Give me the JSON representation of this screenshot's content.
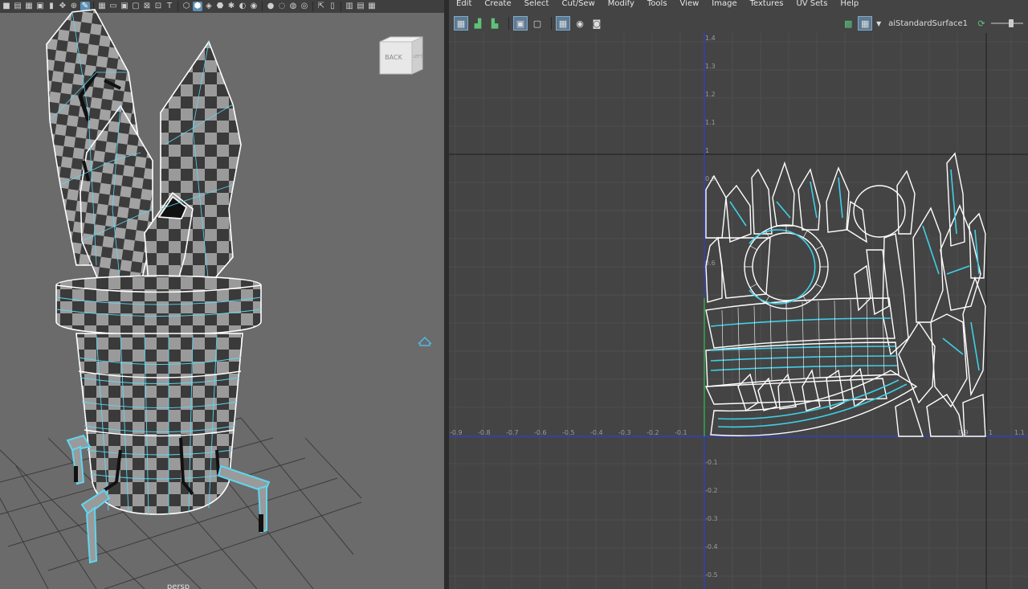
{
  "viewport": {
    "camera_label": "persp",
    "viewcube": {
      "face_front": "BACK",
      "face_side": "LEFT"
    },
    "toolbar_icons": [
      "camera-icon",
      "book-icon",
      "film-icon",
      "image-plane-icon",
      "2d-pan-icon",
      "grease-pencil-icon",
      "grid-icon",
      "wireframe-icon",
      "smooth-shade-icon",
      "textured-icon",
      "lights-icon",
      "shadows-icon",
      "ao-icon",
      "motion-blur-icon",
      "aa-icon",
      "isolate-icon",
      "xray-icon",
      "layout-icon",
      "panel-icon"
    ]
  },
  "uv_editor": {
    "menus": [
      "Edit",
      "Create",
      "Select",
      "Cut/Sew",
      "Modify",
      "Tools",
      "View",
      "Image",
      "Textures",
      "UV Sets",
      "Help"
    ],
    "toolbar_icons": [
      "uv-shell-icon",
      "uv-unfold-icon",
      "uv-layout-icon",
      "uv-grid-icon",
      "uv-snap-icon",
      "uv-checker-icon",
      "uv-isolate-icon",
      "uv-snapshot-icon"
    ],
    "shader_name": "aiStandardSurface1",
    "x_ticks": [
      "-0.9",
      "-0.8",
      "-0.7",
      "-0.6",
      "-0.5",
      "-0.4",
      "-0.3",
      "-0.2",
      "-0.1",
      "0.9",
      "1",
      "1.1"
    ],
    "y_ticks_pos": [
      "1.4",
      "1.3",
      "1.2",
      "1.1",
      "1",
      "0.9",
      "0.6"
    ],
    "y_ticks_neg": [
      "-0.1",
      "-0.2",
      "-0.3",
      "-0.4",
      "-0.5"
    ]
  },
  "colors": {
    "uv_border": "#ffffff",
    "uv_selected": "#3ed0e8",
    "axis_blue": "#2d3fd6",
    "grid": "#505050",
    "wire_cyan": "#5fd6f0"
  }
}
